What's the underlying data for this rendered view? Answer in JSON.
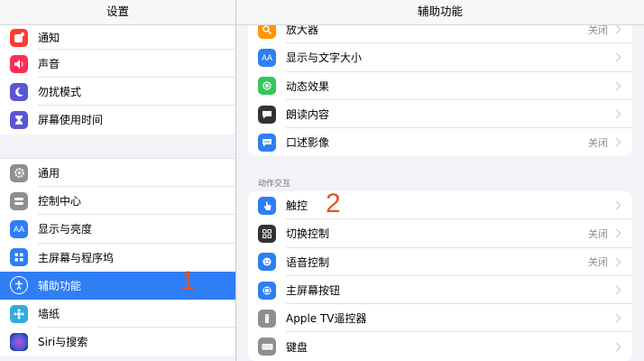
{
  "left": {
    "title": "设置",
    "group1": [
      {
        "label": "通知",
        "icon": "notification-icon",
        "color": "#ff3b30"
      },
      {
        "label": "声音",
        "icon": "sound-icon",
        "color": "#ff2d55"
      },
      {
        "label": "勿扰模式",
        "icon": "moon-icon",
        "color": "#5856d6"
      },
      {
        "label": "屏幕使用时间",
        "icon": "hourglass-icon",
        "color": "#5856d6"
      }
    ],
    "group2": [
      {
        "label": "通用",
        "icon": "gear-icon",
        "color": "#8e8e93"
      },
      {
        "label": "控制中心",
        "icon": "toggle-icon",
        "color": "#8e8e93"
      },
      {
        "label": "显示与亮度",
        "icon": "display-icon",
        "color": "#2f7ef6"
      },
      {
        "label": "主屏幕与程序坞",
        "icon": "homescreen-icon",
        "color": "#2f7ef6"
      },
      {
        "label": "辅助功能",
        "icon": "accessibility-icon",
        "color": "#2f7ef6",
        "selected": true
      },
      {
        "label": "墙纸",
        "icon": "wallpaper-icon",
        "color": "#35aadc"
      },
      {
        "label": "Siri与搜索",
        "icon": "siri-icon",
        "color": "#222222"
      }
    ]
  },
  "right": {
    "title": "辅助功能",
    "vision": [
      {
        "label": "放大器",
        "value": "关闭",
        "icon": "magnifier-icon",
        "color": "#ff9500"
      },
      {
        "label": "显示与文字大小",
        "value": "",
        "icon": "text-size-icon",
        "color": "#2f7ef6"
      },
      {
        "label": "动态效果",
        "value": "",
        "icon": "motion-icon",
        "color": "#34c759"
      },
      {
        "label": "朗读内容",
        "value": "",
        "icon": "speech-icon",
        "color": "#333333"
      },
      {
        "label": "口述影像",
        "value": "关闭",
        "icon": "audio-description-icon",
        "color": "#2f7ef6"
      }
    ],
    "section_title": "动作交互",
    "interaction": [
      {
        "label": "触控",
        "value": "",
        "icon": "touch-icon",
        "color": "#2f7ef6"
      },
      {
        "label": "切换控制",
        "value": "关闭",
        "icon": "switch-control-icon",
        "color": "#333333"
      },
      {
        "label": "语音控制",
        "value": "关闭",
        "icon": "voice-control-icon",
        "color": "#2f7ef6"
      },
      {
        "label": "主屏幕按钮",
        "value": "",
        "icon": "home-button-icon",
        "color": "#2f7ef6"
      },
      {
        "label": "Apple TV遥控器",
        "value": "",
        "icon": "remote-icon",
        "color": "#8e8e93"
      },
      {
        "label": "键盘",
        "value": "",
        "icon": "keyboard-icon",
        "color": "#8e8e93"
      }
    ]
  },
  "annotations": {
    "one": "1",
    "two": "2"
  }
}
